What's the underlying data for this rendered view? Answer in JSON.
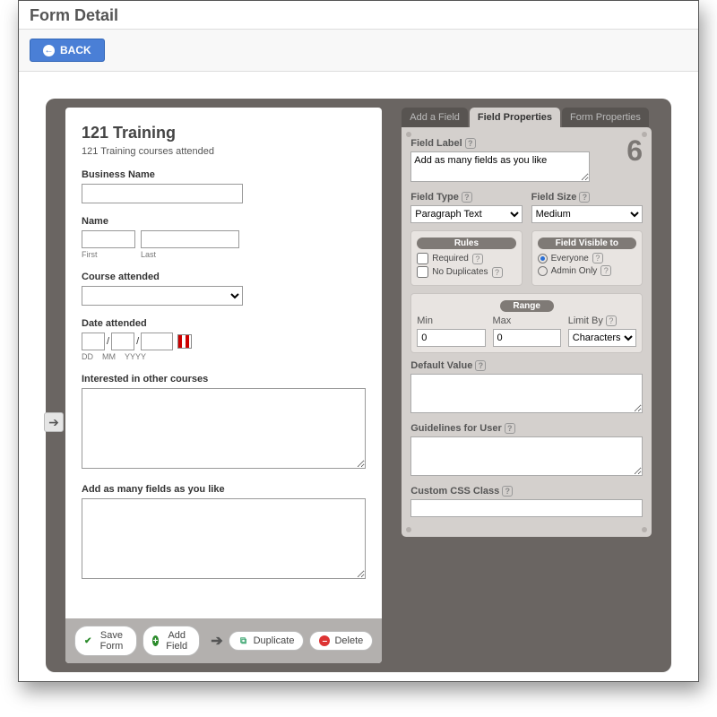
{
  "page": {
    "title": "Form Detail",
    "back_label": "BACK"
  },
  "form": {
    "title": "121 Training",
    "description": "121 Training courses attended",
    "fields": {
      "business_name": {
        "label": "Business Name",
        "value": ""
      },
      "name": {
        "label": "Name",
        "first_sub": "First",
        "last_sub": "Last",
        "first": "",
        "last": ""
      },
      "course": {
        "label": "Course attended",
        "value": ""
      },
      "date": {
        "label": "Date attended",
        "dd": "DD",
        "mm": "MM",
        "yyyy": "YYYY",
        "sep": "/"
      },
      "interested": {
        "label": "Interested in other courses",
        "value": ""
      },
      "extra": {
        "label": "Add as many fields as you like",
        "value": ""
      }
    }
  },
  "buttons": {
    "save": "Save Form",
    "add_field": "Add Field",
    "duplicate": "Duplicate",
    "delete": "Delete"
  },
  "props": {
    "tabs": {
      "add": "Add a Field",
      "field": "Field Properties",
      "form": "Form Properties"
    },
    "step": "6",
    "field_label": {
      "label": "Field Label",
      "value": "Add as many fields as you like"
    },
    "field_type": {
      "label": "Field Type",
      "value": "Paragraph Text"
    },
    "field_size": {
      "label": "Field Size",
      "value": "Medium"
    },
    "rules": {
      "header": "Rules",
      "required": "Required",
      "nodup": "No Duplicates"
    },
    "visibility": {
      "header": "Field Visible to",
      "everyone": "Everyone",
      "admin": "Admin Only",
      "selected": "everyone"
    },
    "range": {
      "header": "Range",
      "min_label": "Min",
      "max_label": "Max",
      "limit_label": "Limit By",
      "min": "0",
      "max": "0",
      "limit": "Characters"
    },
    "default": {
      "label": "Default Value",
      "value": ""
    },
    "guidelines": {
      "label": "Guidelines for User",
      "value": ""
    },
    "css": {
      "label": "Custom CSS Class",
      "value": ""
    }
  }
}
